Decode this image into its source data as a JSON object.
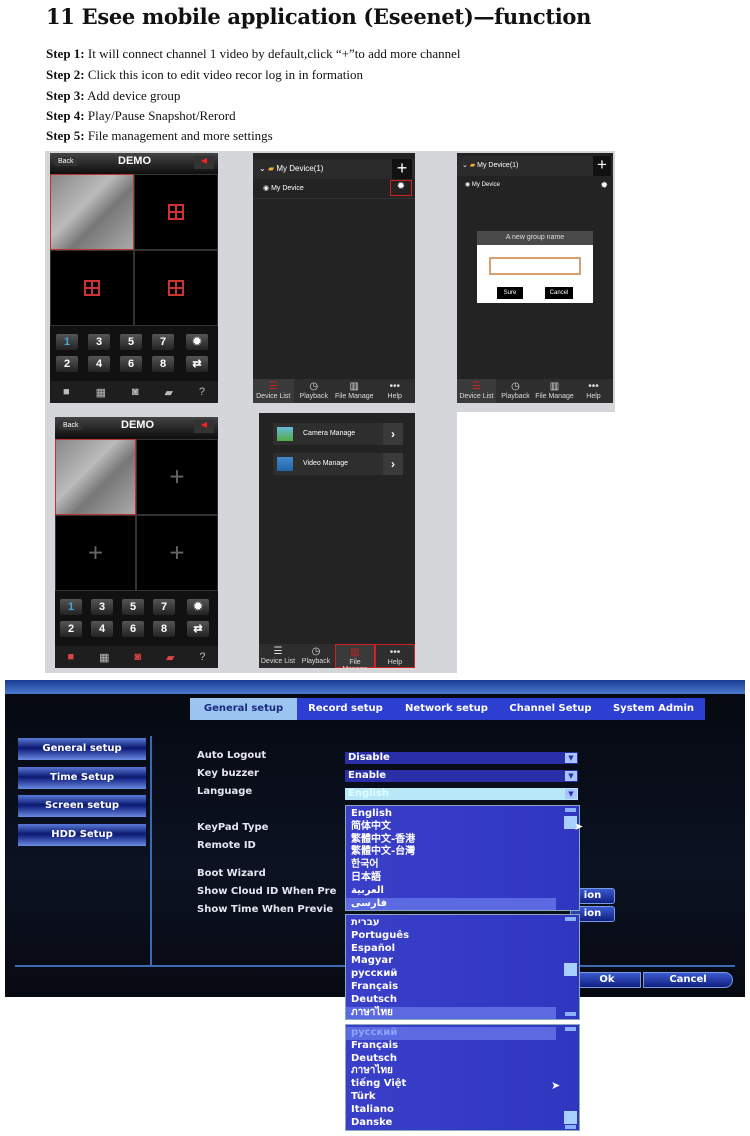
{
  "title": "11 Esee mobile application (Eseenet)—function",
  "steps": [
    {
      "label": "Step 1:",
      "text": " It will connect channel 1 video by default,click “+”to add more channel"
    },
    {
      "label": "Step 2:",
      "text": " Click this icon to edit video recor log in in formation"
    },
    {
      "label": "Step 3:",
      "text": " Add device group"
    },
    {
      "label": "Step 4:",
      "text": " Play/Pause Snapshot/Rerord"
    },
    {
      "label": "Step 5:",
      "text": " File management and more settings"
    }
  ],
  "live": {
    "back": "Back",
    "title": "DEMO",
    "keys": [
      "1",
      "3",
      "5",
      "7",
      "2",
      "4",
      "6",
      "8"
    ]
  },
  "devices": {
    "group": "My Device(1)",
    "device": "My Device",
    "add": "+"
  },
  "dialog": {
    "title": "A new group name",
    "value": "",
    "sure": "Sure",
    "cancel": "Cancel"
  },
  "nav": [
    "Device List",
    "Playback",
    "File Manage",
    "Help"
  ],
  "files": {
    "items": [
      "Camera Manage",
      "Video Manage"
    ]
  },
  "dvr": {
    "tabs": [
      "General setup",
      "Record setup",
      "Network setup",
      "Channel Setup",
      "System Admin"
    ],
    "side": [
      "General setup",
      "Time Setup",
      "Screen setup",
      "HDD Setup"
    ],
    "labels": [
      "Auto Logout",
      "Key buzzer",
      "Language",
      "KeyPad Type",
      "Remote ID",
      "Boot Wizard",
      "Show Cloud ID When Pre",
      "Show Time When Previe"
    ],
    "values": {
      "auto_logout": "Disable",
      "key_buzzer": "Enable",
      "language": "English"
    },
    "position": "ion",
    "ok": "Ok",
    "cancel": "Cancel",
    "list1": [
      "English",
      "简体中文",
      "繁體中文-香港",
      "繁體中文-台灣",
      "한국어",
      "日本語",
      "العربية",
      "فارسی"
    ],
    "list2": [
      "עברית",
      "Português",
      "Español",
      "Magyar",
      "русский",
      "Français",
      "Deutsch",
      "ภาษาไทย"
    ],
    "list3": [
      "русский",
      "Français",
      "Deutsch",
      "ภาษาไทย",
      "tiếng Việt",
      "Türk",
      "Italiano",
      "Danske"
    ]
  }
}
